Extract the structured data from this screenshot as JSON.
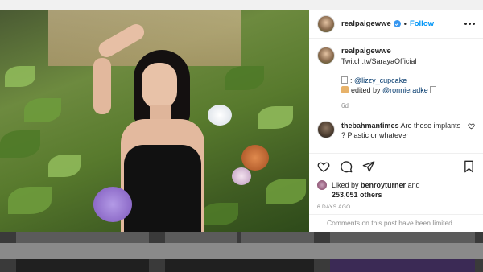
{
  "post": {
    "username": "realpaigewwe",
    "follow_label": "Follow",
    "dot": "•",
    "caption": {
      "line1": "Twitch.tv/SarayaOfficial",
      "credit_prefix": ":",
      "credit_handle": "@lizzy_cupcake",
      "edited_prefix": "edited by",
      "edited_handle": "@ronnieradke",
      "time": "6d"
    },
    "comment": {
      "username": "thebahmantimes",
      "text": "Are those implants ? Plastic or whatever"
    },
    "likes": {
      "prefix": "Liked by",
      "user": "benroyturner",
      "and": "and",
      "count": "253,051 others"
    },
    "posted_ago": "6 DAYS AGO",
    "comments_limited": "Comments on this post have been limited."
  },
  "colors": {
    "accent": "#0095f6",
    "verified": "#3897f0",
    "text": "#262626",
    "muted": "#8e8e8e"
  },
  "icons": [
    "verified-badge-icon",
    "more-options-icon",
    "heart-icon",
    "comment-icon",
    "share-icon",
    "bookmark-icon"
  ]
}
